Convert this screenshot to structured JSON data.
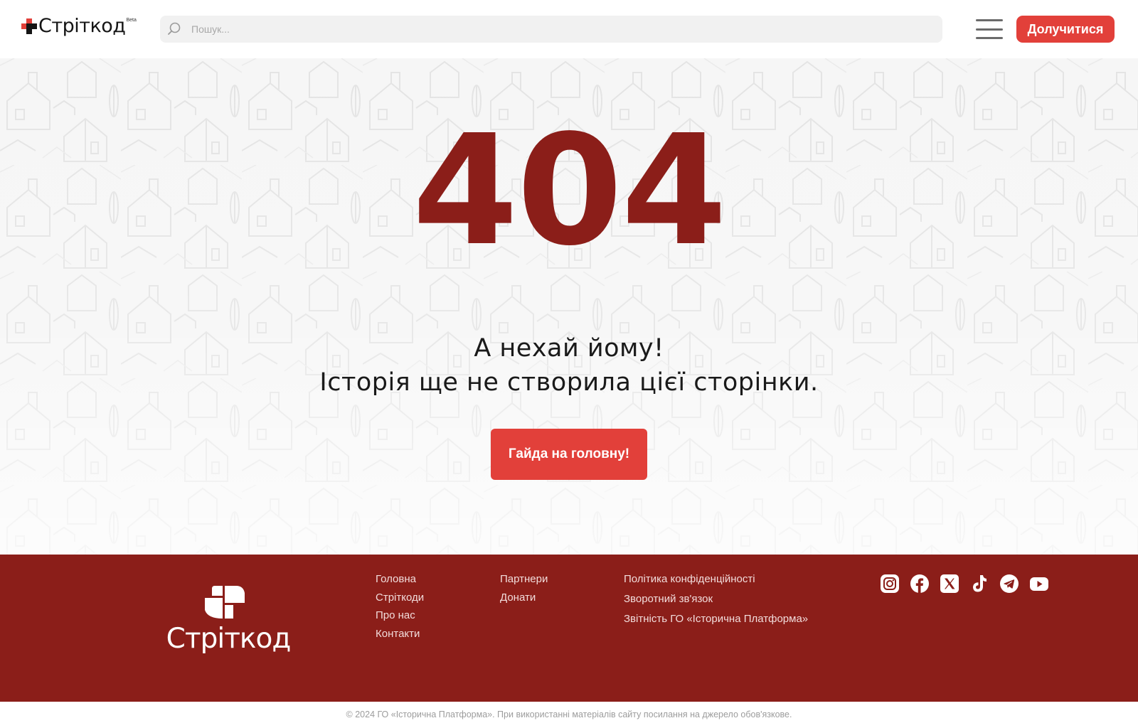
{
  "header": {
    "logo_text": "Стріткод",
    "logo_badge": "Beta",
    "search_placeholder": "Пошук...",
    "join_label": "Долучитися"
  },
  "hero": {
    "code": "404",
    "line1": "А нехай йому!",
    "line2": "Історія ще не створила цієї сторінки.",
    "home_label": "Гайда на головну!"
  },
  "footer": {
    "logo_text": "Стріткод",
    "col1": [
      "Головна",
      "Стріткоди",
      "Про нас",
      "Контакти"
    ],
    "col2": [
      "Партнери",
      "Донати"
    ],
    "col3": [
      "Політика конфіденційності",
      "Зворотний зв'язок",
      "Звітність ГО «Історична Платформа»"
    ],
    "socials": [
      "instagram-icon",
      "facebook-icon",
      "x-icon",
      "tiktok-icon",
      "telegram-icon",
      "youtube-icon"
    ],
    "copyright": "© 2024 ГО «Історична Платформа». При використанні матеріалів сайту посилання на джерело обов'язкове."
  },
  "colors": {
    "accent": "#e2403a",
    "brand_dark": "#8b1e19",
    "footer_text": "#f2dcdb"
  }
}
